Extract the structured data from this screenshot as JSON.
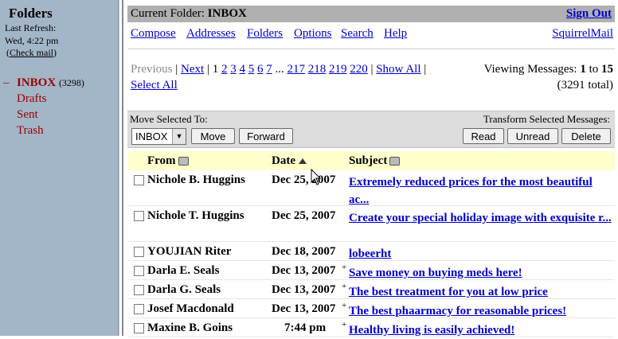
{
  "left": {
    "title": "Folders",
    "last_refresh_label": "Last Refresh:",
    "last_refresh_time": "Wed, 4:22 pm",
    "check_mail": "Check mail",
    "folders": [
      {
        "name": "INBOX",
        "count": "(3298)",
        "active": true
      },
      {
        "name": "Drafts",
        "count": "",
        "active": false
      },
      {
        "name": "Sent",
        "count": "",
        "active": false
      },
      {
        "name": "Trash",
        "count": "",
        "active": false
      }
    ]
  },
  "titlebar": {
    "current_folder_label": "Current Folder:",
    "current_folder": "INBOX",
    "sign_out": "Sign Out"
  },
  "menu": {
    "compose": "Compose",
    "addresses": "Addresses",
    "folders": "Folders",
    "options": "Options",
    "search": "Search",
    "help": "Help",
    "squirrelmail": "SquirrelMail"
  },
  "pager": {
    "previous": "Previous",
    "next": "Next",
    "current_page": "1",
    "pages": [
      "2",
      "3",
      "4",
      "5",
      "6",
      "7"
    ],
    "ellipsis": "...",
    "last_pages": [
      "217",
      "218",
      "219",
      "220"
    ],
    "show_all": "Show All",
    "select_all": "Select All",
    "viewing_label": "Viewing Messages:",
    "viewing_from": "1",
    "viewing_to_word": "to",
    "viewing_to": "15",
    "total": "(3291 total)"
  },
  "toolbar": {
    "move_label": "Move Selected To:",
    "folder_select": "INBOX",
    "move_button": "Move",
    "forward_button": "Forward",
    "transform_label": "Transform Selected Messages:",
    "read_button": "Read",
    "unread_button": "Unread",
    "delete_button": "Delete"
  },
  "table": {
    "headers": {
      "from": "From",
      "date": "Date",
      "subject": "Subject"
    },
    "rows": [
      {
        "from": "Nichole B. Huggins",
        "date": "Dec 25, 2007",
        "flag": "",
        "subject": "Extremely reduced prices for the most beautiful ac..."
      },
      {
        "from": "Nichole T. Huggins",
        "date": "Dec 25, 2007",
        "flag": "",
        "subject": "Create your special holiday image with exquisite r..."
      },
      {
        "from": "YOUJIAN Riter",
        "date": "Dec 18, 2007",
        "flag": "",
        "subject": "lobeerht"
      },
      {
        "from": "Darla E. Seals",
        "date": "Dec 13, 2007",
        "flag": "+",
        "subject": "Save money on buying meds here!"
      },
      {
        "from": "Darla G. Seals",
        "date": "Dec 13, 2007",
        "flag": "+",
        "subject": "The best treatment for you at low price"
      },
      {
        "from": "Josef Macdonald",
        "date": "Dec 13, 2007",
        "flag": "+",
        "subject": "The best phaarmacy for reasonable prices!"
      },
      {
        "from": "Maxine B. Goins",
        "date": "7:44 pm",
        "flag": "+",
        "subject": "Healthy living is easily achieved!"
      }
    ]
  }
}
